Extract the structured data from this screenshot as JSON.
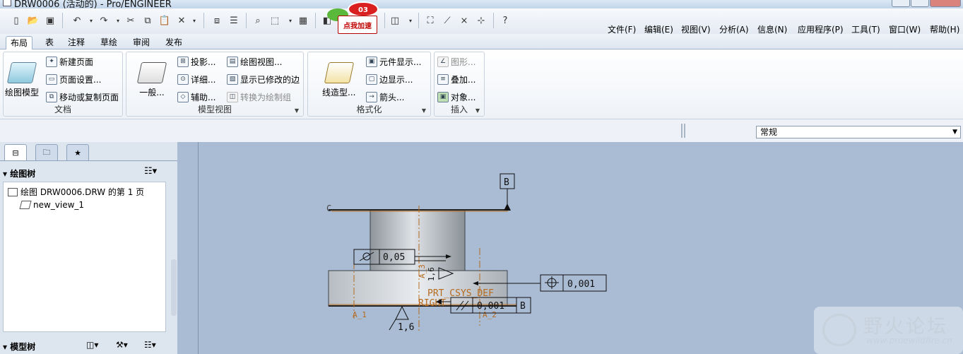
{
  "window": {
    "title": "DRW0006 (活动的) - Pro/ENGINEER"
  },
  "promo": {
    "badge": "03",
    "label": "点我加速"
  },
  "menubar": [
    "文件(F)",
    "编辑(E)",
    "视图(V)",
    "分析(A)",
    "信息(N)",
    "应用程序(P)",
    "工具(T)",
    "窗口(W)",
    "帮助(H)"
  ],
  "tabs": [
    "布局",
    "表",
    "注释",
    "草绘",
    "审阅",
    "发布"
  ],
  "ribbon": {
    "doc_group": {
      "label": "文档",
      "big": "绘图模型",
      "items": [
        "新建页面",
        "页面设置...",
        "移动或复制页面"
      ]
    },
    "model_group": {
      "label": "模型视图",
      "big": "一般...",
      "col1": [
        "投影...",
        "详细...",
        "辅助..."
      ],
      "col2": [
        "绘图视图...",
        "显示已修改的边",
        "转换为绘制组"
      ]
    },
    "format_group": {
      "label": "格式化",
      "big": "线造型...",
      "items": [
        "元件显示...",
        "边显示...",
        "箭头..."
      ]
    },
    "insert_group": {
      "label": "插入",
      "items": [
        "图形...",
        "叠加...",
        "对象..."
      ]
    }
  },
  "style_combo": {
    "value": "常规"
  },
  "panel": {
    "drawing_tree_title": "绘图树",
    "tree_items": [
      "绘图 DRW0006.DRW 的第 1 页",
      "new_view_1"
    ],
    "model_tree_title": "模型树"
  },
  "drawing": {
    "datum_b": "B",
    "fcf_top": {
      "value": "0,05"
    },
    "fcf_right": {
      "value": "0,001"
    },
    "fcf_bottom": {
      "value": "0,001",
      "datum": "B"
    },
    "surface_finish": "1,6",
    "surface_side": "1,6",
    "label_c": "C",
    "coord_label": "PRT_CSYS_DEF",
    "label_right": "RIGHT",
    "axis_1": "A_1",
    "axis_2": "A_2",
    "axis_3": "A_3"
  },
  "watermark": {
    "title": "野火论坛",
    "url": "www.proewildfire.cn"
  }
}
